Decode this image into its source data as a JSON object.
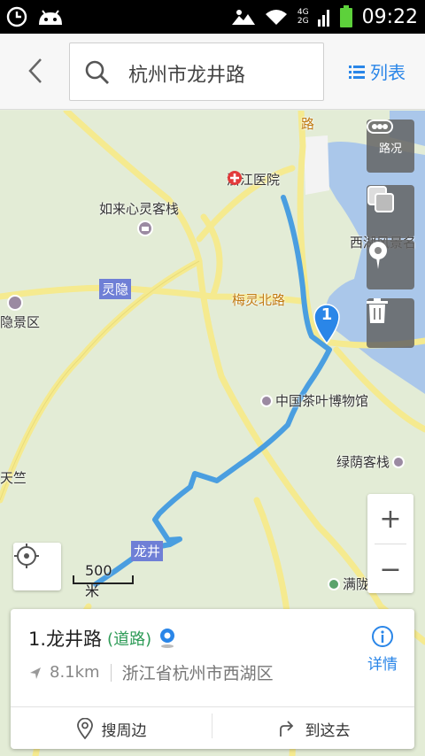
{
  "status_bar": {
    "time": "09:22",
    "network_top": "4G",
    "network_bottom": "2G"
  },
  "top_bar": {
    "search_text": "杭州市龙井路",
    "list_label": "列表"
  },
  "map": {
    "labels": {
      "zhejiang_hospital": "浙江医院",
      "rulai": "如来心灵客栈",
      "lingyin": "灵隐",
      "yin_scenic": "隐景区",
      "meiling_north": "梅灵北路",
      "westlake_scenic": "西湖风景名",
      "tea_museum": "中国茶叶博物馆",
      "lvyin_inn": "绿荫客栈",
      "tianzhu": "天竺",
      "longjing_tag": "龙井",
      "manlong": "满陇",
      "road_lu": "路"
    },
    "controls": {
      "traffic_label": "路况"
    },
    "marker_number": "1",
    "scale_text": "500米",
    "zoom_in": "+",
    "zoom_out": "−"
  },
  "result_card": {
    "title": "1.龙井路",
    "type": "(道路)",
    "distance": "8.1km",
    "address": "浙江省杭州市西湖区",
    "detail_label": "详情",
    "search_nearby": "搜周边",
    "go_here": "到这去"
  },
  "colors": {
    "accent": "#2a86e8",
    "route": "#4a9ee0",
    "road": "#f5ea8f",
    "water": "#aac7ea"
  },
  "icons": [
    "back-arrow-icon",
    "search-icon",
    "list-icon",
    "traffic-icon",
    "layers-icon",
    "pin-icon",
    "trash-icon",
    "locate-icon",
    "info-icon",
    "nearby-pin-icon",
    "navigate-icon"
  ]
}
